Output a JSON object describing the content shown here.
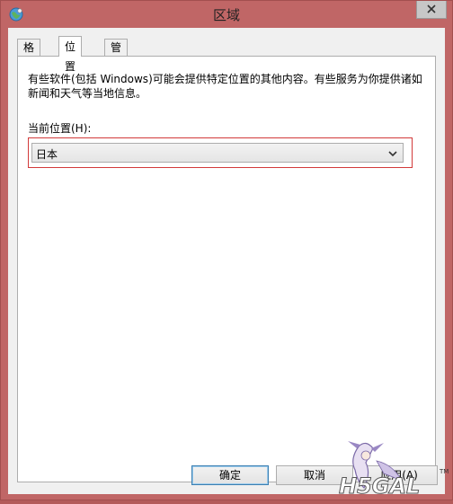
{
  "window": {
    "title": "区域",
    "accent": "#c06666"
  },
  "tabs": [
    {
      "label": "格式"
    },
    {
      "label": "位置"
    },
    {
      "label": "管理"
    }
  ],
  "location_tab": {
    "description": "有些软件(包括 Windows)可能会提供特定位置的其他内容。有些服务为你提供诸如新闻和天气等当地信息。",
    "current_location_label": "当前位置(H):",
    "current_location_value": "日本"
  },
  "buttons": {
    "ok": "确定",
    "cancel": "取消",
    "apply": "应用(A)"
  },
  "icons": {
    "app": "globe-icon",
    "close": "close-icon",
    "dropdown": "chevron-down-icon"
  }
}
